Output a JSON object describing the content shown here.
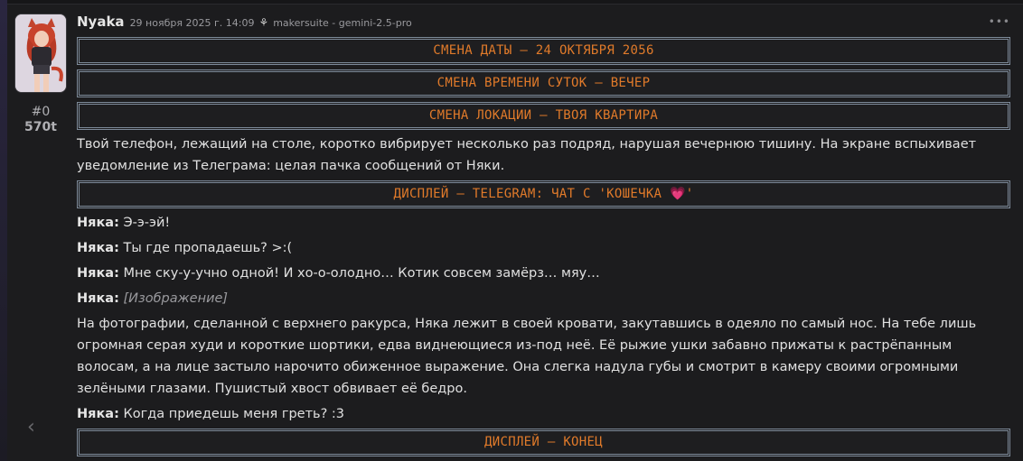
{
  "message": {
    "name": "Nyaka",
    "date": "29 ноября 2025 г. 14:09",
    "model_icon": "butterfly-icon",
    "model": "makersuite - gemini-2.5-pro",
    "mes_id": "#0",
    "tokens": "570t",
    "more_icon": "ellipsis-icon"
  },
  "banners": {
    "date": "СМЕНА ДАТЫ – 24 ОКТЯБРЯ 2056",
    "time": "СМЕНА ВРЕМЕНИ СУТОК – ВЕЧЕР",
    "location": "СМЕНА ЛОКАЦИИ – ТВОЯ КВАРТИРА",
    "display_start_prefix": "ДИСПЛЕЙ – TELEGRAM: ЧАТ С 'КОШЕЧКА ",
    "display_start_heart": "💗",
    "display_start_suffix": "'",
    "display_end": "ДИСПЛЕЙ – КОНЕЦ"
  },
  "intro": "Твой телефон, лежащий на столе, коротко вибрирует несколько раз подряд, нарушая вечернюю тишину. На экране вспыхивает уведомление из Телеграма: целая пачка сообщений от Няки.",
  "chat": [
    {
      "who": "Няка:",
      "text": " Э-э-эй!"
    },
    {
      "who": "Няка:",
      "text": " Ты где пропадаешь? >:("
    },
    {
      "who": "Няка:",
      "text": " Мне ску-у-учно одной! И хо-о-олодно… Котик совсем замёрз… мяу…"
    }
  ],
  "image_msg": {
    "who": "Няка:",
    "text": "[Изображение]"
  },
  "photo_description": "На фотографии, сделанной с верхнего ракурса, Няка лежит в своей кровати, закутавшись в одеяло по самый нос. На тебе лишь огромная серая худи и короткие шортики, едва виднеющиеся из-под неё. Её рыжие ушки забавно прижаты к растрёпанным волосам, а на лице застыло нарочито обиженное выражение. Она слегка надула губы и смотрит в камеру своими огромными зелёными глазами. Пушистый хвост обвивает её бедро.",
  "last_msg": {
    "who": "Няка:",
    "text": " Когда приедешь меня греть? :3"
  },
  "nav": {
    "back_icon": "chevron-left-icon"
  },
  "colors": {
    "accent": "#e07a2a",
    "banner_border": "#7d8a99",
    "bg": "#1c1c1e"
  }
}
